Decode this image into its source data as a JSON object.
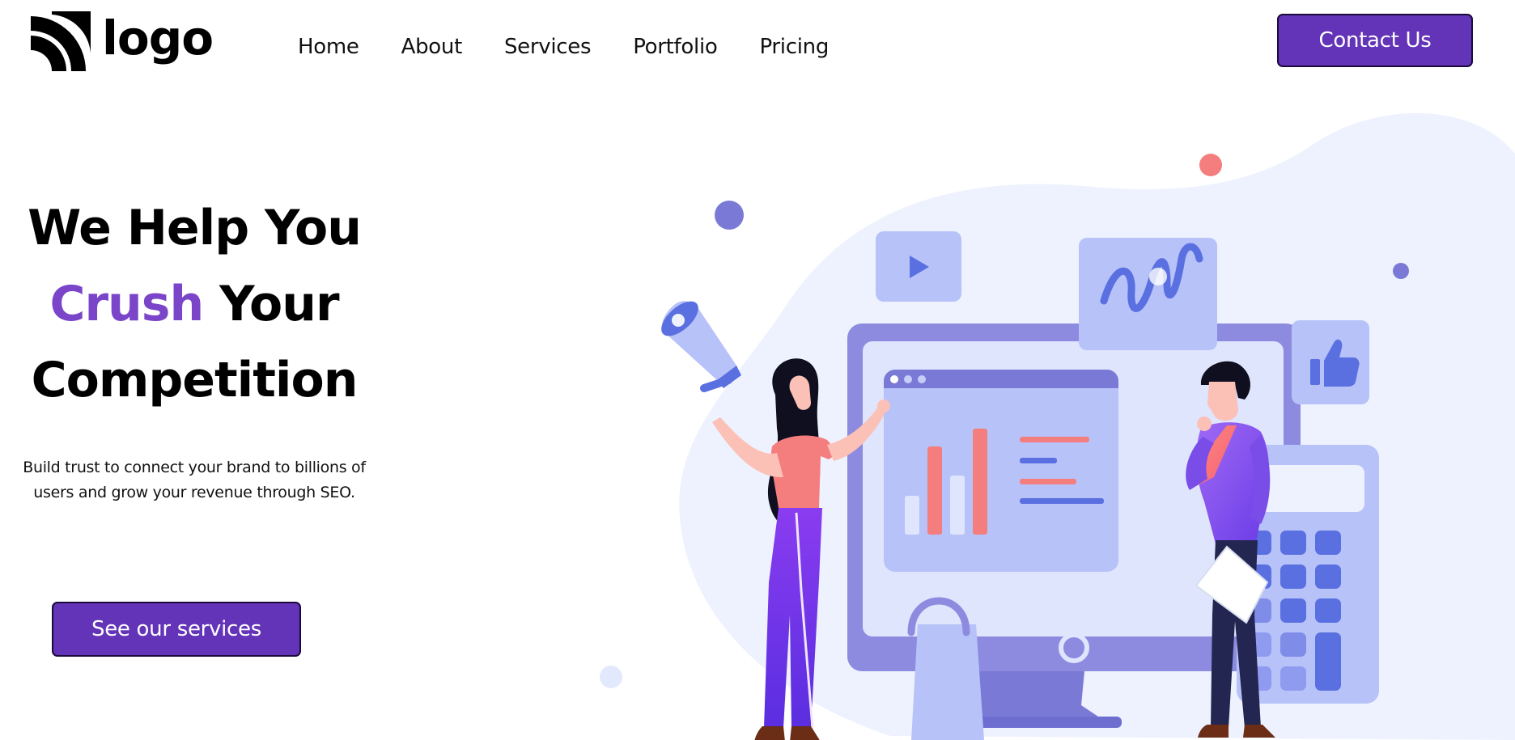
{
  "header": {
    "logo_text": "logo",
    "nav": [
      {
        "label": "Home"
      },
      {
        "label": "About"
      },
      {
        "label": "Services"
      },
      {
        "label": "Portfolio"
      },
      {
        "label": "Pricing"
      }
    ],
    "contact_label": "Contact Us"
  },
  "hero": {
    "title_line1": "We Help You",
    "title_accent": "Crush",
    "title_line2_rest": " Your",
    "title_line3": "Competition",
    "subtitle_line1": "Build trust to connect your brand to billions of",
    "subtitle_line2": "users and grow your revenue through SEO.",
    "cta_label": "See our services"
  },
  "colors": {
    "primary": "#6333b8",
    "accent_text": "#7a45c9",
    "illustration_blob": "#eef2fe",
    "illustration_purple": "#7a7ad6",
    "illustration_pink": "#f47e7e"
  },
  "illustration": {
    "icons": [
      "megaphone-icon",
      "play-icon",
      "wave-chart-icon",
      "thumbs-up-icon",
      "shopping-bag-icon",
      "calculator-icon"
    ]
  }
}
